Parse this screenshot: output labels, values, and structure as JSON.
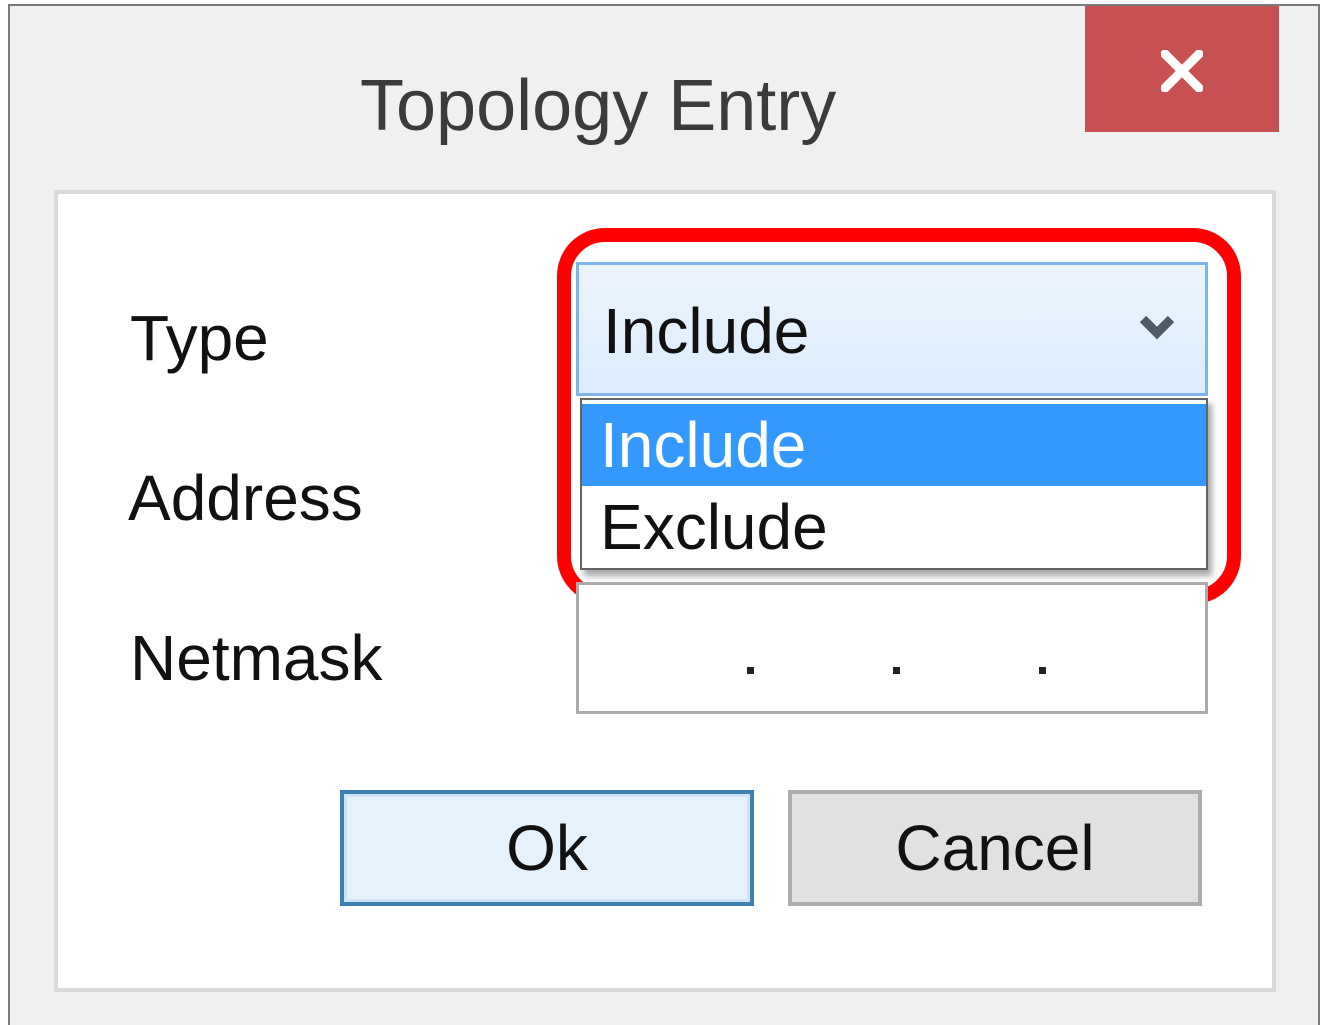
{
  "window": {
    "title": "Topology Entry",
    "close_icon": "close-icon",
    "close_color": "#c75050"
  },
  "form": {
    "type_label": "Type",
    "address_label": "Address",
    "netmask_label": "Netmask",
    "type_select": {
      "selected": "Include",
      "icon": "chevron-down-icon",
      "expanded": true,
      "options": [
        "Include",
        "Exclude"
      ],
      "highlighted_option": "Include"
    },
    "netmask": {
      "value": "",
      "separator": "."
    }
  },
  "buttons": {
    "ok_label": "Ok",
    "cancel_label": "Cancel"
  },
  "colors": {
    "selection": "#3399ff",
    "highlight_ring": "#ff0000",
    "focus_border": "#3c7fb1"
  }
}
